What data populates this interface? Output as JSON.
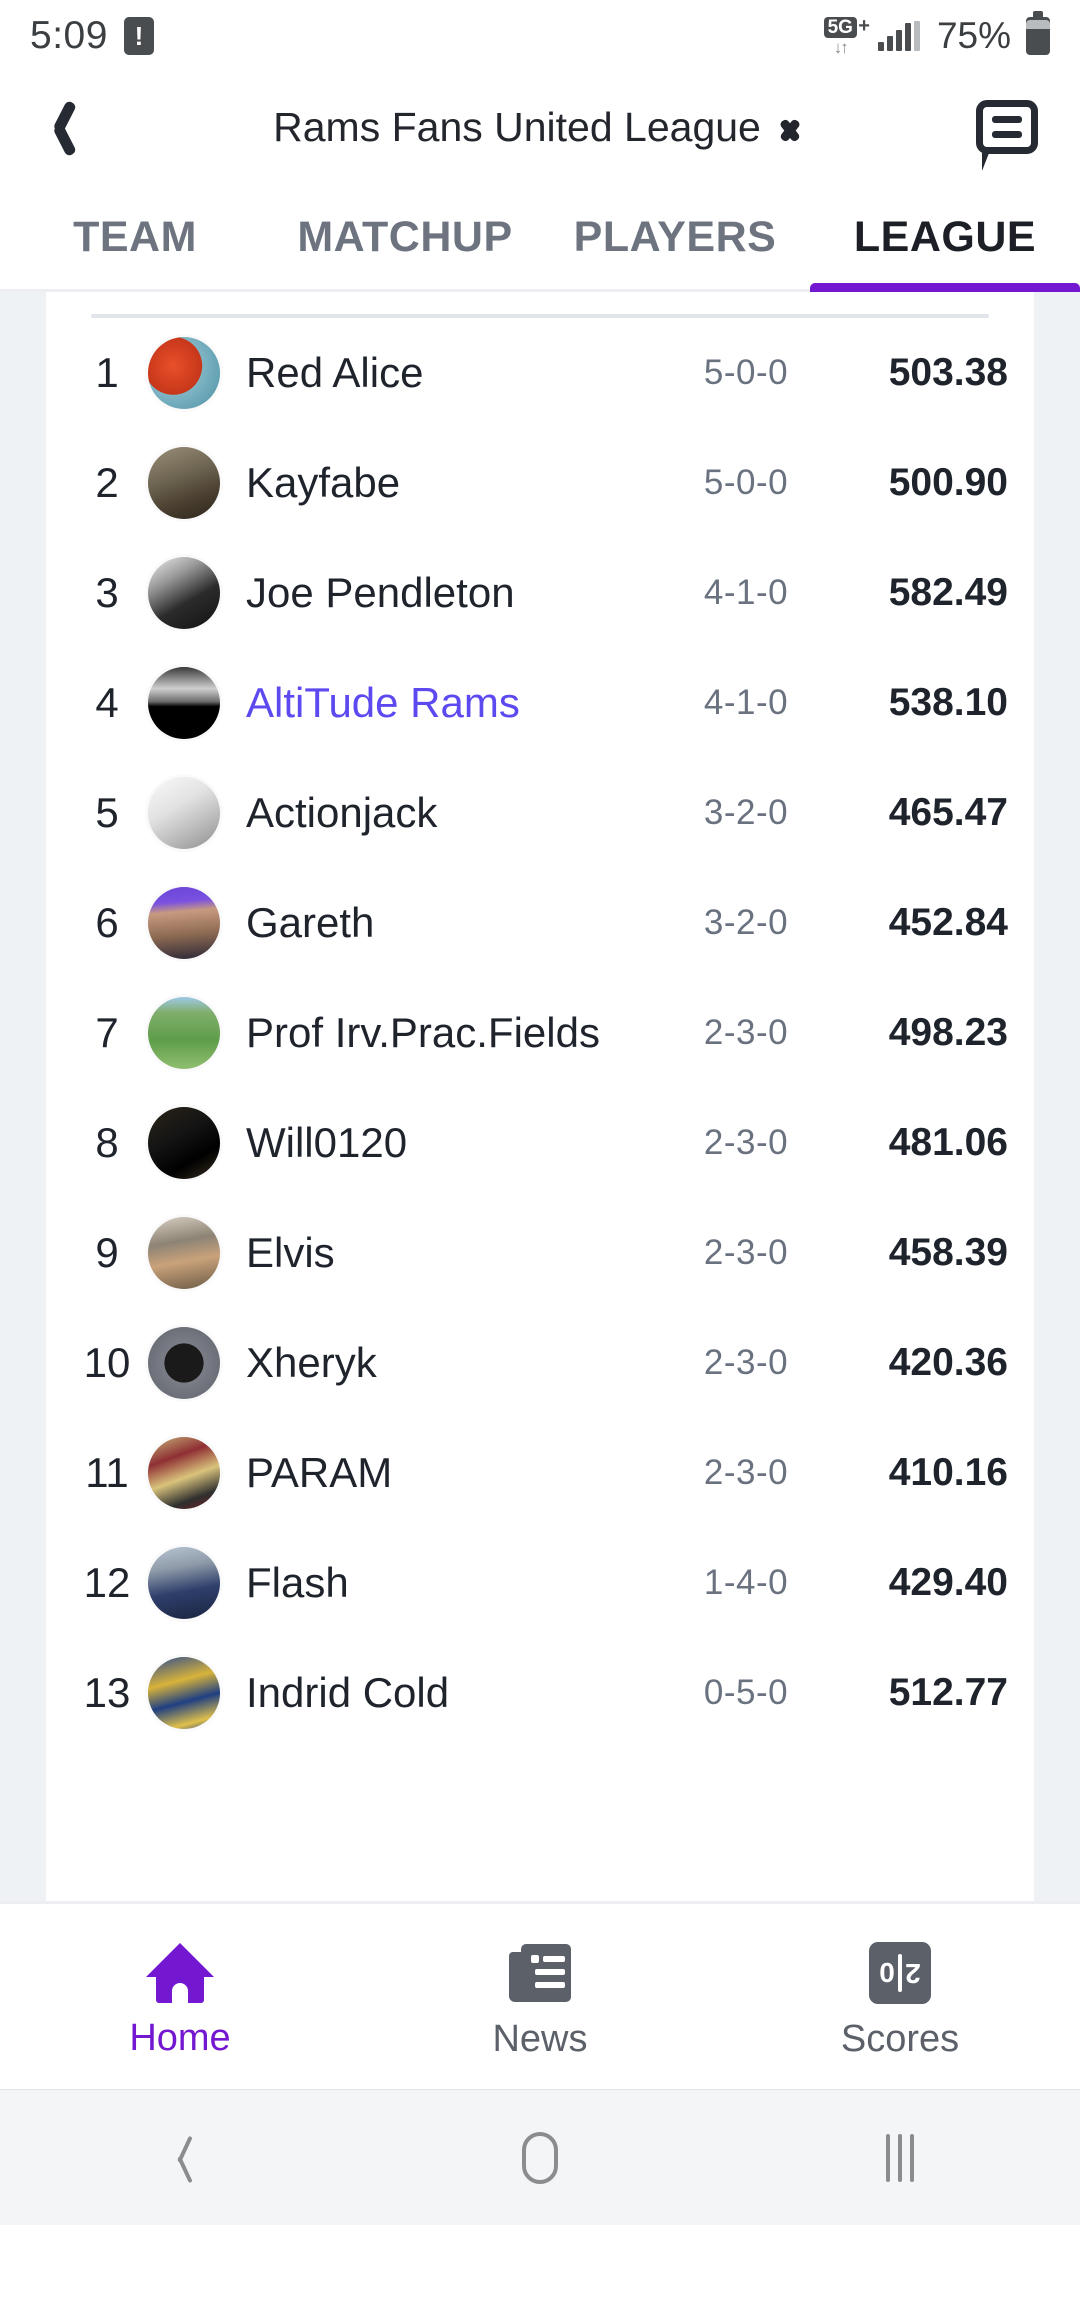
{
  "status_bar": {
    "time": "5:09",
    "alert_glyph": "!",
    "network": "5G",
    "network_plus": "+",
    "network_arrows": "↓↑",
    "battery_percent": "75%"
  },
  "app_bar": {
    "title": "Rams Fans United League",
    "back_icon": "chevron-left-icon",
    "expand_icon": "chevron-up-icon",
    "chat_icon": "chat-bubble-icon"
  },
  "section_tabs": {
    "items": [
      {
        "label": "TEAM",
        "active": false
      },
      {
        "label": "MATCHUP",
        "active": false
      },
      {
        "label": "PLAYERS",
        "active": false
      },
      {
        "label": "LEAGUE",
        "active": true
      }
    ],
    "active_color": "#7417d0"
  },
  "standings": {
    "my_team_color": "#5d49f0",
    "rows": [
      {
        "rank": "1",
        "name": "Red Alice",
        "record": "5-0-0",
        "points": "503.38",
        "mine": false,
        "avatar": "avatar-red-alice"
      },
      {
        "rank": "2",
        "name": "Kayfabe",
        "record": "5-0-0",
        "points": "500.90",
        "mine": false,
        "avatar": "avatar-kayfabe"
      },
      {
        "rank": "3",
        "name": "Joe Pendleton",
        "record": "4-1-0",
        "points": "582.49",
        "mine": false,
        "avatar": "avatar-joe-pendleton"
      },
      {
        "rank": "4",
        "name": "AltiTude Rams",
        "record": "4-1-0",
        "points": "538.10",
        "mine": true,
        "avatar": "avatar-altitude-rams"
      },
      {
        "rank": "5",
        "name": "Actionjack",
        "record": "3-2-0",
        "points": "465.47",
        "mine": false,
        "avatar": "avatar-actionjack"
      },
      {
        "rank": "6",
        "name": "Gareth",
        "record": "3-2-0",
        "points": "452.84",
        "mine": false,
        "avatar": "avatar-gareth"
      },
      {
        "rank": "7",
        "name": "Prof Irv.Prac.Fields",
        "record": "2-3-0",
        "points": "498.23",
        "mine": false,
        "avatar": "avatar-prof-irv"
      },
      {
        "rank": "8",
        "name": "Will0120",
        "record": "2-3-0",
        "points": "481.06",
        "mine": false,
        "avatar": "avatar-will0120"
      },
      {
        "rank": "9",
        "name": "Elvis",
        "record": "2-3-0",
        "points": "458.39",
        "mine": false,
        "avatar": "avatar-elvis"
      },
      {
        "rank": "10",
        "name": "Xheryk",
        "record": "2-3-0",
        "points": "420.36",
        "mine": false,
        "avatar": "avatar-xheryk"
      },
      {
        "rank": "11",
        "name": "PARAM",
        "record": "2-3-0",
        "points": "410.16",
        "mine": false,
        "avatar": "avatar-param"
      },
      {
        "rank": "12",
        "name": "Flash",
        "record": "1-4-0",
        "points": "429.40",
        "mine": false,
        "avatar": "avatar-flash"
      },
      {
        "rank": "13",
        "name": "Indrid Cold",
        "record": "0-5-0",
        "points": "512.77",
        "mine": false,
        "avatar": "avatar-indrid-cold"
      }
    ]
  },
  "bottom_nav": {
    "items": [
      {
        "label": "Home",
        "icon": "home-icon",
        "active": true
      },
      {
        "label": "News",
        "icon": "news-icon",
        "active": false
      },
      {
        "label": "Scores",
        "icon": "scoreboard-icon",
        "active": false
      }
    ],
    "active_color": "#7417d0",
    "scores_icon_left": "0",
    "scores_icon_right": "2"
  },
  "system_nav": {
    "back_icon": "system-back-icon",
    "home_icon": "system-home-icon",
    "recents_icon": "system-recents-icon"
  }
}
